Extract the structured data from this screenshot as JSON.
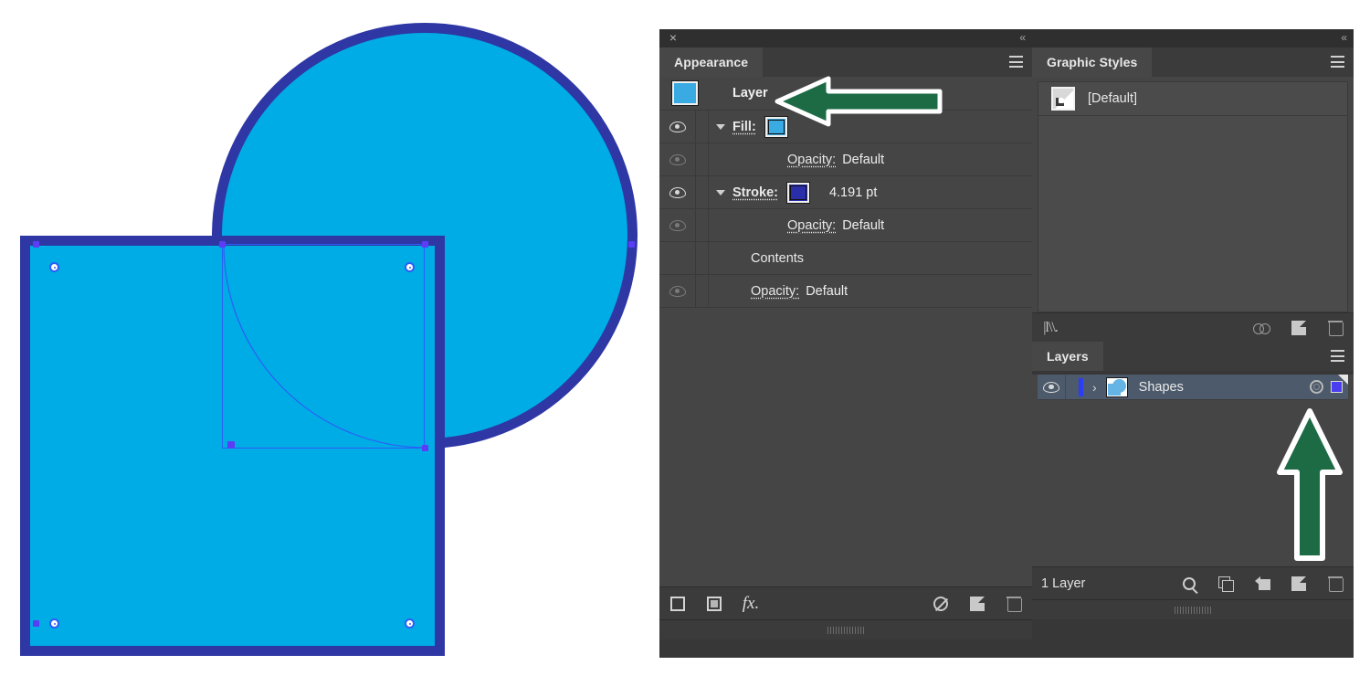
{
  "app": {
    "theme_bg": "#454545",
    "accent_blue": "#00ace6",
    "stroke_blue": "#2e37a4",
    "annotation_green": "#1d6b45"
  },
  "canvas": {
    "name": "artboard-canvas",
    "shapes": [
      {
        "name": "circle",
        "fill": "#00ace6",
        "stroke": "#2e37a4"
      },
      {
        "name": "square",
        "fill": "#00ace6",
        "stroke": "#2e37a4",
        "selected": true
      }
    ]
  },
  "appearance_panel": {
    "close_label": "×",
    "collapse_label": "«",
    "tab_label": "Appearance",
    "menu_label": "panel-menu",
    "header": {
      "title": "Layer",
      "thumb_color": "#3aaae2"
    },
    "rows": [
      {
        "label": "Fill:",
        "value": "",
        "swatch": "#3aaae2",
        "has_eye": true,
        "eye_dim": false,
        "has_disclosure": true,
        "indent": 0
      },
      {
        "label": "Opacity:",
        "value": "Default",
        "swatch": "",
        "has_eye": true,
        "eye_dim": true,
        "has_disclosure": false,
        "indent": 1
      },
      {
        "label": "Stroke:",
        "value": "4.191 pt",
        "swatch": "#2a2ea8",
        "has_eye": true,
        "eye_dim": false,
        "has_disclosure": true,
        "indent": 0
      },
      {
        "label": "Opacity:",
        "value": "Default",
        "swatch": "",
        "has_eye": true,
        "eye_dim": true,
        "has_disclosure": false,
        "indent": 1
      },
      {
        "label": "Contents",
        "value": "",
        "swatch": "",
        "has_eye": false,
        "eye_dim": false,
        "has_disclosure": false,
        "indent": 0
      },
      {
        "label": "Opacity:",
        "value": "Default",
        "swatch": "",
        "has_eye": true,
        "eye_dim": true,
        "has_disclosure": false,
        "indent": 0
      }
    ],
    "footer_icons": [
      {
        "name": "add-new-stroke-icon",
        "glyph": "square-outline"
      },
      {
        "name": "add-new-fill-icon",
        "glyph": "square-filled"
      },
      {
        "name": "add-new-effect-icon",
        "glyph": "fx"
      },
      {
        "name": "clear-appearance-icon",
        "glyph": "no-symbol"
      },
      {
        "name": "duplicate-selected-item-icon",
        "glyph": "duplicate"
      },
      {
        "name": "delete-selected-item-icon",
        "glyph": "trash"
      }
    ]
  },
  "graphic_styles_panel": {
    "collapse_label": "«",
    "tab_label": "Graphic Styles",
    "items": [
      {
        "label": "[Default]",
        "name": "graphic-style-default"
      }
    ],
    "footer_icons": [
      {
        "name": "graphic-styles-libraries-icon",
        "glyph": "library"
      },
      {
        "name": "break-link-to-graphic-style-icon",
        "glyph": "break-link"
      },
      {
        "name": "new-graphic-style-icon",
        "glyph": "duplicate"
      },
      {
        "name": "delete-graphic-style-icon",
        "glyph": "trash"
      }
    ]
  },
  "layers_panel": {
    "tab_label": "Layers",
    "rows": [
      {
        "name": "Shapes",
        "visible": true,
        "expanded": false,
        "color": "#2b3ef5",
        "targeted": true,
        "selection_color": "#4a3ff0"
      }
    ],
    "footer_count": "1 Layer",
    "footer_icons": [
      {
        "name": "locate-object-icon",
        "glyph": "magnifier"
      },
      {
        "name": "make-clipping-mask-icon",
        "glyph": "two-squares"
      },
      {
        "name": "create-new-sublayer-icon",
        "glyph": "sublayer"
      },
      {
        "name": "create-new-layer-icon",
        "glyph": "duplicate"
      },
      {
        "name": "delete-selection-icon",
        "glyph": "trash"
      }
    ]
  },
  "annotations": [
    {
      "name": "arrow-pointing-to-layer-row",
      "direction": "left",
      "color": "#1d6b45"
    },
    {
      "name": "arrow-pointing-to-layer-target",
      "direction": "up",
      "color": "#1d6b45"
    }
  ]
}
